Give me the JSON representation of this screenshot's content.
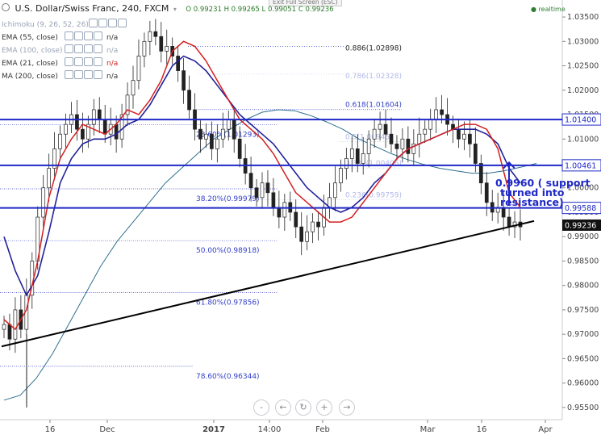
{
  "header": {
    "title": "U.S. Dollar/Swiss Franc, 240, FXCM",
    "ohlc": "O 0.99231 H 0.99265 L 0.99051 C 0.99236",
    "exit_fullscreen": "Exit Full Screen (ESC)",
    "realtime": "realtime"
  },
  "legend": [
    {
      "label": "Ichimoku (9, 26, 52, 26)",
      "value": "",
      "faded": true
    },
    {
      "label": "EMA (55, close)",
      "value": "n/a",
      "faded": false
    },
    {
      "label": "EMA (100, close)",
      "value": "n/a",
      "faded": true
    },
    {
      "label": "EMA (21, close)",
      "value": "n/a",
      "faded": false,
      "red": true
    },
    {
      "label": "MA (200, close)",
      "value": "n/a",
      "faded": false
    }
  ],
  "controls": [
    "-",
    "←",
    "↻",
    "+",
    "→"
  ],
  "colors": {
    "hline": "#1f29c7",
    "ema21": "#d42020",
    "ema55": "#22229a",
    "ma200": "#2e6f8f",
    "trendline": "#000000",
    "fib": "#3440c8",
    "price_tag": "#1f29c7",
    "last_price_bg": "#111111",
    "annotation": "#1f29c7"
  },
  "chart_data": {
    "type": "candlestick",
    "title": "U.S. Dollar/Swiss Franc, 240, FXCM",
    "ylim": [
      0.9525,
      1.0365
    ],
    "y_ticks": [
      "1.03500",
      "1.03000",
      "1.02500",
      "1.02000",
      "1.01500",
      "1.01000",
      "1.00500",
      "1.00000",
      "0.99500",
      "0.99000",
      "0.98500",
      "0.98000",
      "0.97500",
      "0.97000",
      "0.96500",
      "0.96000",
      "0.95500"
    ],
    "x_ticks": [
      "16",
      "Dec",
      "2017",
      "14:00",
      "Feb",
      "Mar",
      "16",
      "Apr"
    ],
    "horizontal_levels": [
      {
        "value": 1.014,
        "label": "1.01400"
      },
      {
        "value": 1.00461,
        "label": "1.00461"
      },
      {
        "value": 0.99588,
        "label": "0.99588"
      }
    ],
    "last_price": {
      "value": 0.99236,
      "label": "0.99236"
    },
    "fib_left": [
      {
        "label": "0.886(1.02898)",
        "value": 1.02898
      },
      {
        "label": "0.786(1.02328)",
        "value": 1.02328
      },
      {
        "label": "0.618(1.01604)",
        "value": 1.01604
      },
      {
        "label": "23.60%(1.01293)",
        "value": 1.01293
      },
      {
        "label": "0.5(1.00945)",
        "value": 1.00945
      },
      {
        "label": "0.382(1.00406)",
        "value": 1.00406
      },
      {
        "label": "38.20%(0.99979)",
        "value": 0.99979
      },
      {
        "label": "0.236(0.99759)",
        "value": 0.99759
      },
      {
        "label": "50.00%(0.98918)",
        "value": 0.98918
      },
      {
        "label": "61.80%(0.97856)",
        "value": 0.97856
      },
      {
        "label": "78.60%(0.96344)",
        "value": 0.96344
      }
    ],
    "annotation": "0.9960 ( support turned into resistance)",
    "trendline": [
      [
        0.9675,
        0
      ],
      [
        0.9932,
        1
      ]
    ],
    "ema21": [
      0.973,
      0.971,
      0.975,
      0.985,
      0.998,
      1.006,
      1.01,
      1.013,
      1.012,
      1.011,
      1.013,
      1.016,
      1.015,
      1.018,
      1.022,
      1.028,
      1.03,
      1.029,
      1.026,
      1.022,
      1.018,
      1.014,
      1.012,
      1.01,
      1.007,
      1.003,
      0.999,
      0.997,
      0.995,
      0.993,
      0.993,
      0.994,
      0.997,
      1.0,
      1.003,
      1.006,
      1.008,
      1.009,
      1.01,
      1.011,
      1.012,
      1.013,
      1.013,
      1.012,
      1.008,
      0.999,
      0.996
    ],
    "ema55": [
      0.99,
      0.983,
      0.978,
      0.982,
      0.991,
      1.001,
      1.006,
      1.009,
      1.01,
      1.01,
      1.011,
      1.013,
      1.014,
      1.017,
      1.021,
      1.025,
      1.027,
      1.026,
      1.024,
      1.021,
      1.018,
      1.015,
      1.013,
      1.011,
      1.009,
      1.006,
      1.003,
      1.0,
      0.998,
      0.996,
      0.995,
      0.996,
      0.998,
      1.001,
      1.003,
      1.006,
      1.008,
      1.009,
      1.01,
      1.011,
      1.012,
      1.012,
      1.012,
      1.011,
      1.009,
      1.004,
      1.001
    ],
    "ma200": [
      0.9565,
      0.9575,
      0.961,
      0.966,
      0.972,
      0.978,
      0.984,
      0.989,
      0.993,
      0.997,
      1.001,
      1.004,
      1.007,
      1.01,
      1.012,
      1.014,
      1.0155,
      1.016,
      1.0158,
      1.0148,
      1.0135,
      1.012,
      1.01,
      1.0085,
      1.007,
      1.0058,
      1.0048,
      1.004,
      1.0035,
      1.003,
      1.003,
      1.0035,
      1.0042,
      1.005
    ],
    "candles": [
      0.972,
      0.969,
      0.975,
      0.971,
      0.978,
      0.985,
      0.994,
      1.0,
      1.004,
      1.008,
      1.011,
      1.013,
      1.015,
      1.012,
      1.01,
      1.013,
      1.016,
      1.014,
      1.011,
      1.013,
      1.01,
      1.015,
      1.019,
      1.022,
      1.027,
      1.03,
      1.032,
      1.031,
      1.028,
      1.029,
      1.027,
      1.024,
      1.02,
      1.016,
      1.012,
      1.01,
      1.011,
      1.008,
      1.01,
      1.012,
      1.014,
      1.01,
      1.006,
      1.003,
      1.0,
      0.998,
      1.001,
      0.999,
      0.996,
      0.994,
      0.997,
      0.995,
      0.992,
      0.989,
      0.991,
      0.993,
      0.992,
      0.996,
      0.998,
      1.001,
      1.004,
      1.006,
      1.008,
      1.005,
      1.007,
      1.01,
      1.012,
      1.013,
      1.011,
      1.009,
      1.008,
      1.01,
      1.007,
      1.009,
      1.011,
      1.012,
      1.014,
      1.016,
      1.015,
      1.013,
      1.012,
      1.01,
      1.011,
      1.009,
      1.005,
      1.001,
      0.997,
      0.995,
      0.996,
      0.994,
      0.992,
      0.993,
      0.992
    ]
  }
}
